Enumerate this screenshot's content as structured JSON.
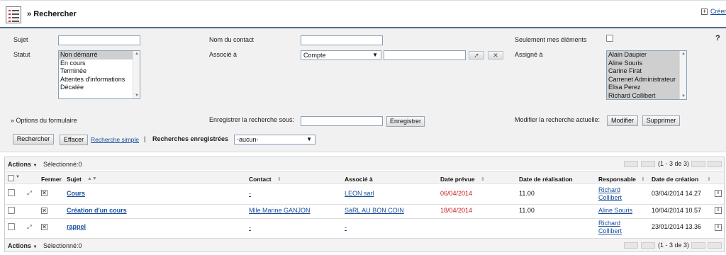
{
  "header": {
    "title": "Rechercher",
    "create_label": "Créer",
    "module_icon": "document-list-icon",
    "accent_color": "#4d6e8e"
  },
  "search": {
    "sujet_label": "Sujet",
    "sujet_value": "",
    "contact_label": "Nom du contact",
    "contact_value": "",
    "only_mine_label": "Seulement mes éléments",
    "help": "?",
    "statut_label": "Statut",
    "statut_options": [
      "Non démarré",
      "En cours",
      "Terminée",
      "Attentes d'informations",
      "Décalée"
    ],
    "associe_label": "Associé à",
    "associe_select": "Compte",
    "associe_value": "",
    "assigne_label": "Assigné à",
    "assigne_options": [
      "Alain Daupier",
      "Aline Souris",
      "Carine Firat",
      "Carrenet Administrateur",
      "Elisa Perez",
      "Richard Collibert"
    ],
    "options_label": "Options du formulaire",
    "save_search_label": "Enregistrer la recherche sous:",
    "save_search_value": "",
    "save_button": "Enregistrer",
    "modify_label": "Modifier la recherche actuelle:",
    "modify_button": "Modifier",
    "delete_button": "Supprimer",
    "search_button": "Rechercher",
    "clear_button": "Effacer",
    "simple_search_link": "Recherche simple",
    "separator": "|",
    "saved_searches_label": "Recherches enregistrées",
    "saved_searches_value": "-aucun-"
  },
  "results": {
    "actions_label": "Actions",
    "selected_label": "Sélectionné:0",
    "pager_text": "(1 - 3 de 3)",
    "columns": {
      "fermer": "Fermer",
      "sujet": "Sujet",
      "contact": "Contact",
      "associe": "Associé à",
      "date_prevue": "Date prévue",
      "date_realisation": "Date de réalisation",
      "responsable": "Responsable",
      "date_creation": "Date de création"
    },
    "rows": [
      {
        "sujet": "Cours",
        "contact": "-",
        "associe": "LEON sarl",
        "date_prevue": "06/04/2014",
        "date_realisation": "11.00",
        "responsable_1": "Richard",
        "responsable_2": "Collibert",
        "date_creation": "03/04/2014 14.27"
      },
      {
        "sujet": "Création d'un cours",
        "contact": "Mlle Marine GANJON",
        "associe": "SàRL AU BON COIN",
        "date_prevue": "18/04/2014",
        "date_realisation": "11.00",
        "responsable_1": "Aline Souris",
        "responsable_2": "",
        "date_creation": "10/04/2014 10.57"
      },
      {
        "sujet": "rappel",
        "contact": "-",
        "associe": "-",
        "date_prevue": "",
        "date_realisation": "",
        "responsable_1": "Richard",
        "responsable_2": "Collibert",
        "date_creation": "23/01/2014 13.36"
      }
    ],
    "overdue_color": "#c61a1a",
    "link_color": "#1a4f9c"
  }
}
